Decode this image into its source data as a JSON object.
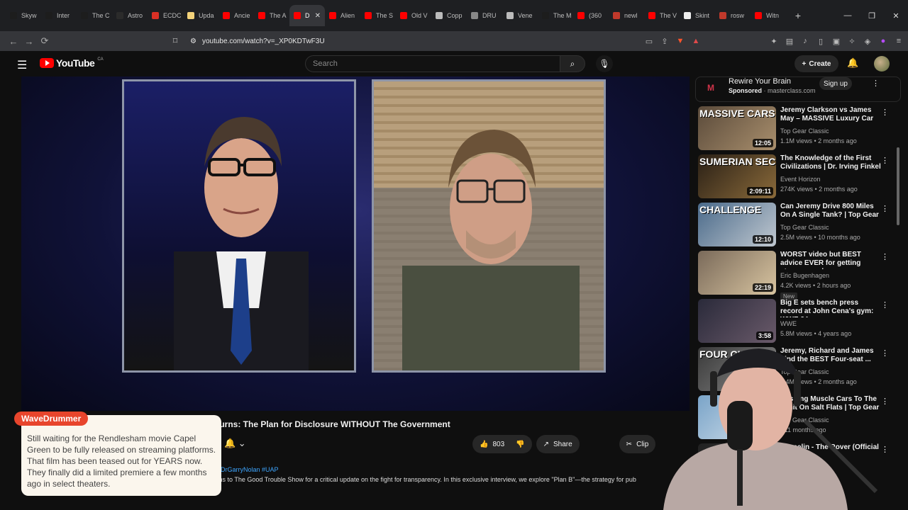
{
  "browser": {
    "tabs": [
      {
        "label": "Skyw",
        "fav": "#1d1d1d",
        "icon": "x-icon"
      },
      {
        "label": "Inter",
        "fav": "#1d1d1d",
        "icon": "x-icon"
      },
      {
        "label": "The C",
        "fav": "#1d1d1d",
        "icon": "x-icon"
      },
      {
        "label": "Astro",
        "fav": "#2b2b2b",
        "icon": "doc-icon"
      },
      {
        "label": "ECDC",
        "fav": "#d93025",
        "icon": "pdf-icon"
      },
      {
        "label": "Upda",
        "fav": "#f3d27a",
        "icon": "doc-icon"
      },
      {
        "label": "Ancie",
        "fav": "#ff0000",
        "icon": "youtube-icon"
      },
      {
        "label": "The A",
        "fav": "#ff0000",
        "icon": "youtube-icon"
      },
      {
        "label": "D",
        "fav": "#ff0000",
        "icon": "youtube-icon",
        "active": true
      },
      {
        "label": "Alien",
        "fav": "#ff0000",
        "icon": "youtube-icon"
      },
      {
        "label": "The S",
        "fav": "#ff0000",
        "icon": "youtube-icon"
      },
      {
        "label": "Old V",
        "fav": "#ff0000",
        "icon": "youtube-icon"
      },
      {
        "label": "Copp",
        "fav": "#bbbbbb",
        "icon": "globe-icon"
      },
      {
        "label": "DRU",
        "fav": "#888888",
        "icon": "globe-icon"
      },
      {
        "label": "Vene",
        "fav": "#bbbbbb",
        "icon": "globe-icon"
      },
      {
        "label": "The M",
        "fav": "#1d1d1d",
        "icon": "x-icon"
      },
      {
        "label": "(360",
        "fav": "#ff0000",
        "icon": "youtube-icon"
      },
      {
        "label": "newl",
        "fav": "#c0392b",
        "icon": "globe-icon"
      },
      {
        "label": "The V",
        "fav": "#ff0000",
        "icon": "youtube-icon"
      },
      {
        "label": "Skint",
        "fav": "#eeeeee",
        "icon": "globe-icon"
      },
      {
        "label": "rosw",
        "fav": "#c0392b",
        "icon": "globe-icon"
      },
      {
        "label": "Witn",
        "fav": "#ff0000",
        "icon": "youtube-icon"
      }
    ],
    "new_tab": "+",
    "url": "youtube.com/watch?v=_XP0KDTwF3U"
  },
  "youtube": {
    "logo_text": "YouTube",
    "region": "CA",
    "search_placeholder": "Search",
    "create_label": "Create"
  },
  "video": {
    "title": "Returns: The Plan for Disclosure WITHOUT The Government",
    "likes": "803",
    "share_label": "Share",
    "clip_label": "Clip",
    "hashtags": "DrGarryNolan #UAP",
    "description": "returns to The Good Trouble Show for a critical update on the fight for transparency. In this exclusive interview, we explore \"Plan B\"—the strategy for pub"
  },
  "sidebar": {
    "ad": {
      "title": "Rewire Your Brain",
      "sponsored": "Sponsored",
      "domain": "masterclass.com",
      "cta": "Sign up"
    },
    "videos": [
      {
        "title": "Jeremy Clarkson vs James May – MASSIVE Luxury Car ...",
        "channel": "Top Gear Classic",
        "stats": "1.1M views • 2 months ago",
        "duration": "12:05",
        "overlay": "MASSIVE CARS",
        "thumb": [
          "#5a4a3a",
          "#a98f6d"
        ]
      },
      {
        "title": "The Knowledge of the First Civilizations | Dr. Irving Finkel",
        "channel": "Event Horizon",
        "stats": "274K views • 2 months ago",
        "duration": "2:09:11",
        "overlay": "SUMERIAN SECRETS",
        "thumb": [
          "#2a2016",
          "#8a6a3a"
        ]
      },
      {
        "title": "Can Jeremy Drive 800 Miles On A Single Tank? | Top Gear ...",
        "channel": "Top Gear Classic",
        "stats": "2.5M views • 10 months ago",
        "duration": "12:10",
        "overlay": "CHALLENGE",
        "thumb": [
          "#4a6a8a",
          "#c0c8d0"
        ]
      },
      {
        "title": "WORST video but BEST advice EVER for getting stronger and ...",
        "channel": "Eric Bugenhagen",
        "stats": "4.2K views • 2 hours ago",
        "duration": "22:19",
        "overlay": "",
        "thumb": [
          "#7a6a5a",
          "#d8c4a0"
        ],
        "badge": "New"
      },
      {
        "title": "Big E sets bench press record at John Cena's gym: WWE 24 ...",
        "channel": "WWE",
        "stats": "5.8M views • 4 years ago",
        "duration": "3:58",
        "overlay": "",
        "thumb": [
          "#2a2a3a",
          "#6a5a6a"
        ]
      },
      {
        "title": "Jeremy, Richard and James Find the BEST Four-seat ...",
        "channel": "Top Gear Classic",
        "stats": "2.4M views • 2 months ago",
        "duration": "12:05",
        "overlay": "FOUR CHALLENGE",
        "thumb": [
          "#3a3a3a",
          "#8a8a8a"
        ]
      },
      {
        "title": "Pushing Muscle Cars To The Limit On Salt Flats | Top Gear ...",
        "channel": "Top Gear Classic",
        "stats": "• 11 months ago",
        "duration": "",
        "overlay": "",
        "thumb": [
          "#7aa4c8",
          "#d8e4ee"
        ]
      },
      {
        "title": "Zeppelin - The Rover (Official Audio)",
        "channel": "",
        "stats": "4 months ago",
        "duration": "",
        "overlay": "",
        "thumb": [
          "#202020",
          "#505050"
        ]
      }
    ]
  },
  "chat": {
    "author": "WaveDrummer",
    "message": "Still waiting for the Rendlesham movie Capel Green to be fully released on streaming platforms. That film has been teased out for YEARS now. They finally did a limited premiere a few months ago in select theaters."
  },
  "colors": {
    "accent": "#ff0000",
    "chat_badge": "#e8452c",
    "link": "#3ea6ff"
  }
}
